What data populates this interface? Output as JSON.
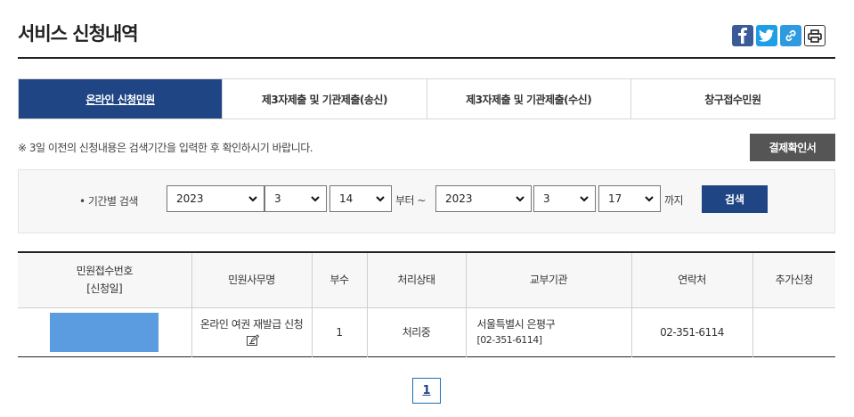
{
  "page": {
    "title": "서비스 신청내역"
  },
  "share": {
    "icons": [
      "facebook-icon",
      "twitter-icon",
      "link-icon",
      "print-icon"
    ]
  },
  "tabs": [
    {
      "label": "온라인 신청민원",
      "active": true
    },
    {
      "label": "제3자제출 및 기관제출(송신)",
      "active": false
    },
    {
      "label": "제3자제출 및 기관제출(수신)",
      "active": false
    },
    {
      "label": "창구접수민원",
      "active": false
    }
  ],
  "notice": "※ 3일 이전의 신청내용은 검색기간을 입력한 후 확인하시기 바랍니다.",
  "payment_button": "결제확인서",
  "search": {
    "label": "• 기간별 검색",
    "from": {
      "year": "2023",
      "month": "3",
      "day": "14"
    },
    "from_suffix": "부터 ~",
    "to": {
      "year": "2023",
      "month": "3",
      "day": "17"
    },
    "to_suffix": "까지",
    "button": "검색"
  },
  "table": {
    "headers": [
      "민원접수번호",
      "[신청일]",
      "민원사무명",
      "부수",
      "처리상태",
      "교부기관",
      "연락처",
      "추가신청"
    ],
    "rows": [
      {
        "service": "온라인 여권 재발급 신청",
        "copies": "1",
        "status": "처리중",
        "agency": "서울특별시 은평구",
        "agency_phone": "[02-351-6114]",
        "contact": "02-351-6114",
        "extra": ""
      }
    ]
  },
  "pagination": {
    "current": "1"
  },
  "colors": {
    "primary": "#1f4585",
    "redacted": "#5b9be0",
    "pay_button": "#555555"
  }
}
